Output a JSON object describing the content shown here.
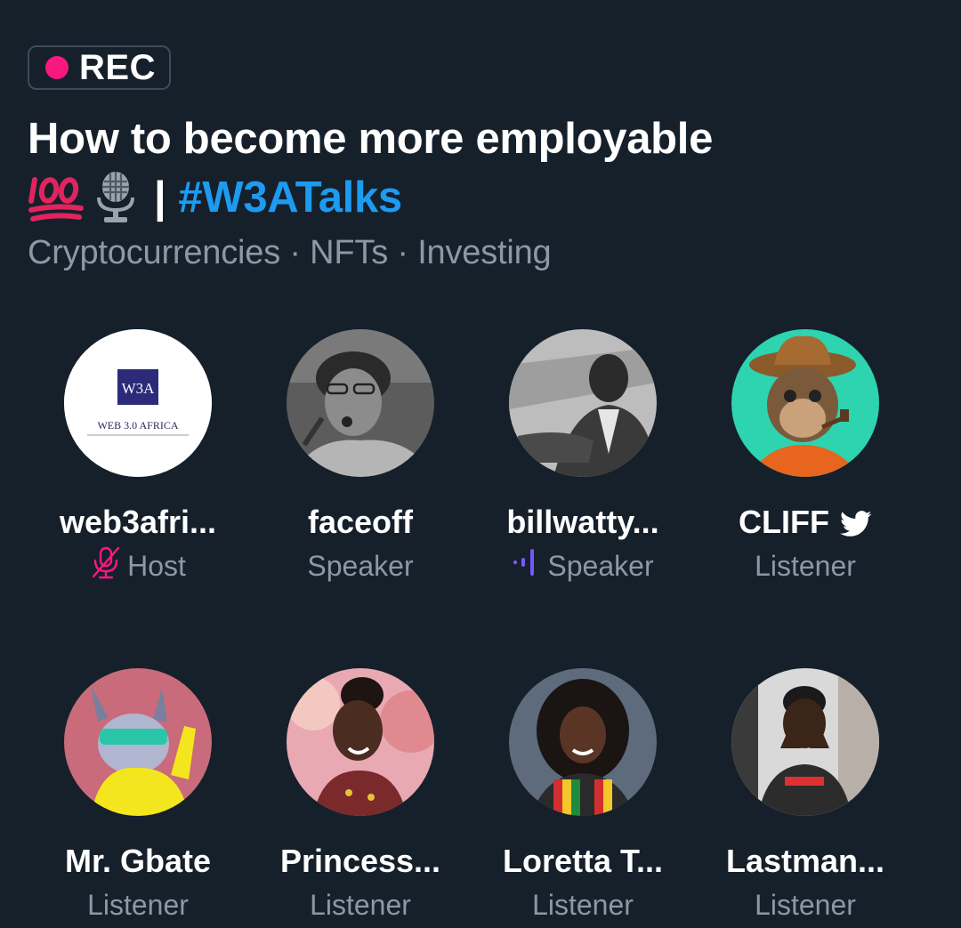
{
  "space": {
    "recording_label": "REC",
    "title_line1": "How to become more employable",
    "title_separator": "|",
    "hashtag": "#W3ATalks",
    "topics": "Cryptocurrencies · NFTs · Investing"
  },
  "participants": [
    {
      "name": "web3afri...",
      "role": "Host",
      "role_icon": "mic-off-icon",
      "avatar_logo_text": "W3A",
      "avatar_caption": "WEB 3.0 AFRICA"
    },
    {
      "name": "faceoff",
      "role": "Speaker"
    },
    {
      "name": "billwatty...",
      "role": "Speaker",
      "role_icon": "speaking-icon"
    },
    {
      "name": "CLIFF",
      "role": "Listener",
      "name_icon": "twitter-bird-icon"
    },
    {
      "name": "Mr. Gbate",
      "role": "Listener"
    },
    {
      "name": "Princess...",
      "role": "Listener"
    },
    {
      "name": "Loretta T...",
      "role": "Listener"
    },
    {
      "name": "Lastman...",
      "role": "Listener"
    }
  ],
  "colors": {
    "background": "#15202b",
    "rec_dot": "#f91880",
    "hashtag": "#1d9bf0",
    "muted_text": "#8b98a5",
    "speaking_accent": "#7856ff",
    "mic_off": "#f91880"
  }
}
